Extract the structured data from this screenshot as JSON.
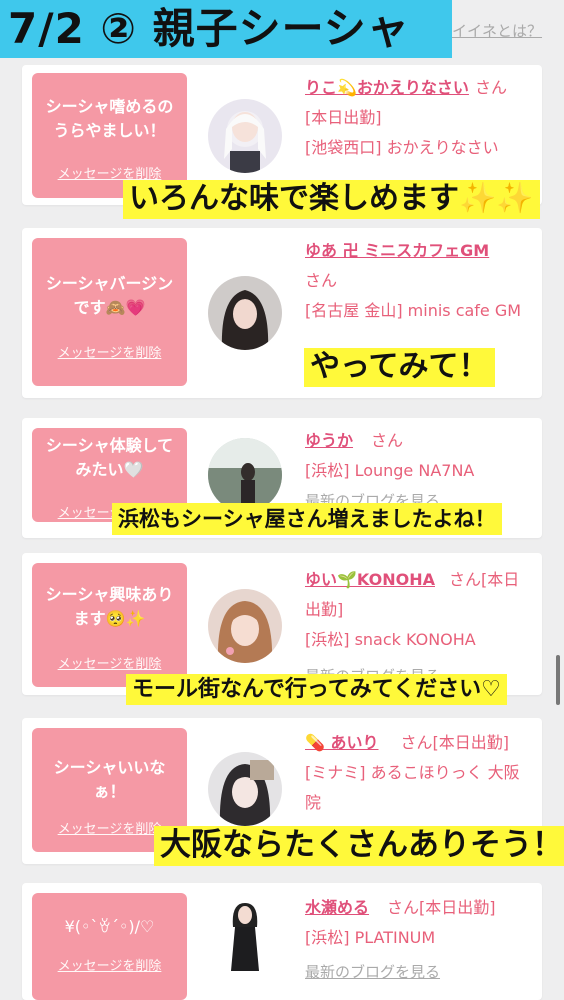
{
  "title": "7/2 ② 親子シーシャ",
  "iine_link": "イイネとは？",
  "cards": [
    {
      "message": "シーシャ嗜めるの\nうらやましい！",
      "delete_label": "メッセージを削除",
      "name": "りこ💫おかえりなさい",
      "san": "さん",
      "lines": [
        "[本日出勤]",
        "[池袋西口] おかえりなさい"
      ],
      "overlay": "いろんな味で楽しめます✨✨"
    },
    {
      "message": "シーシャバージン\nです🙈💗",
      "delete_label": "メッセージを削除",
      "name": "ゆあ 卍 ミニスカフェGM",
      "san": "さん",
      "lines": [
        "[名古屋 金山] minis cafe GM"
      ],
      "overlay": "やってみて！"
    },
    {
      "message": "シーシャ体験して\nみたい🤍",
      "delete_label": "メッセージを削除",
      "name": "ゆうか",
      "san": "さん",
      "lines": [
        "[浜松] Lounge NA7NA"
      ],
      "blog": "最新のブログを見る",
      "overlay": "浜松もシーシャ屋さん増えましたよね！"
    },
    {
      "message": "シーシャ興味あり\nます🥺✨",
      "delete_label": "メッセージを削除",
      "name": "ゆい🌱KONOHA",
      "san": "さん[本日出勤]",
      "lines": [
        "[浜松] snack KONOHA"
      ],
      "blog": "最新のブログを見る",
      "overlay": "モール街なんで行ってみてください♡"
    },
    {
      "message": "シーシャいいな\nぁ！",
      "delete_label": "メッセージを削除",
      "name": "💊 あいり",
      "san": "さん[本日出勤]",
      "lines": [
        "[ミナミ] あるこほりっく 大阪院"
      ],
      "overlay": "大阪ならたくさんありそう！"
    },
    {
      "message": "¥(◦`ꈊ´◦)/♡",
      "delete_label": "メッセージを削除",
      "name": "水瀬める",
      "san": "さん[本日出勤]",
      "lines": [
        "[浜松] PLATINUM"
      ],
      "blog": "最新のブログを見る"
    }
  ],
  "colors": {
    "banner": "#3fc8ec",
    "message_box": "#f599a5",
    "name_link": "#e0507a",
    "overlay": "#fff93a"
  }
}
